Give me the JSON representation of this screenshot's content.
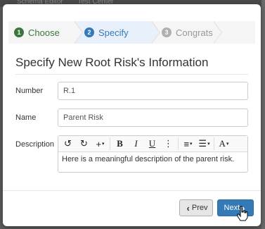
{
  "backdrop": {
    "items": [
      "Schema Editor",
      "Test Center"
    ]
  },
  "wizard": {
    "steps": [
      {
        "number": "1",
        "label": "Choose",
        "state": "completed"
      },
      {
        "number": "2",
        "label": "Specify",
        "state": "active"
      },
      {
        "number": "3",
        "label": "Congrats",
        "state": "pending"
      }
    ]
  },
  "form": {
    "title": "Specify New Root Risk's Information",
    "number_label": "Number",
    "number_value": "R.1",
    "name_label": "Name",
    "name_value": "Parent Risk",
    "description_label": "Description",
    "description_value": "Here is a meaningful description of the parent risk."
  },
  "toolbar": {
    "undo_icon": "↺",
    "redo_icon": "↻",
    "insert_icon": "+",
    "bold_icon": "B",
    "italic_icon": "I",
    "underline_icon": "U",
    "more_icon": "⋮",
    "align_icon": "≡",
    "list_icon": "☰",
    "font_icon": "A"
  },
  "footer": {
    "prev_label": "Prev",
    "next_label": "Next"
  },
  "colors": {
    "primary": "#337ab7",
    "success": "#3c763d",
    "muted": "#999999"
  }
}
